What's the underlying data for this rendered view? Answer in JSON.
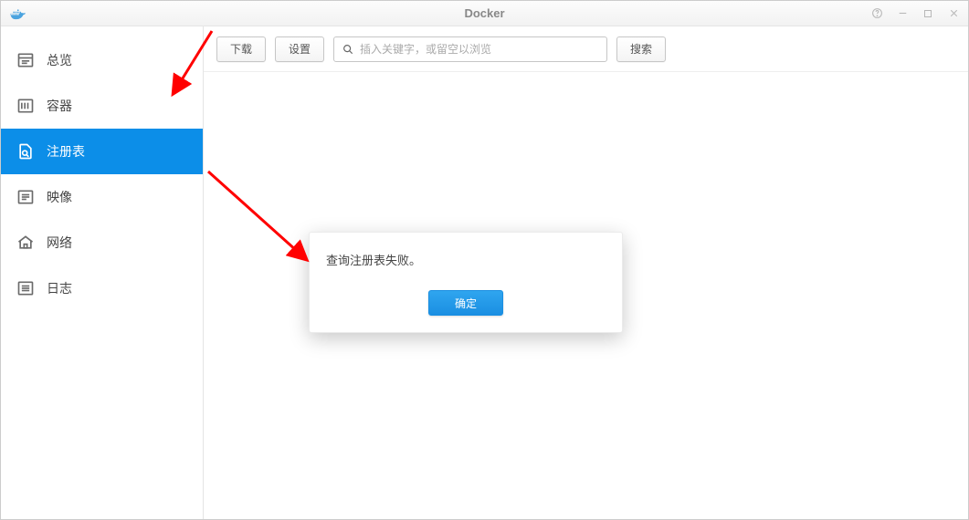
{
  "window": {
    "title": "Docker"
  },
  "sidebar": {
    "items": [
      {
        "label": "总览"
      },
      {
        "label": "容器"
      },
      {
        "label": "注册表"
      },
      {
        "label": "映像"
      },
      {
        "label": "网络"
      },
      {
        "label": "日志"
      }
    ],
    "activeIndex": 2
  },
  "toolbar": {
    "download_label": "下载",
    "settings_label": "设置",
    "search_placeholder": "插入关键字，或留空以浏览",
    "search_value": "",
    "search_button_label": "搜索"
  },
  "dialog": {
    "message": "查询注册表失败。",
    "ok_label": "确定"
  }
}
